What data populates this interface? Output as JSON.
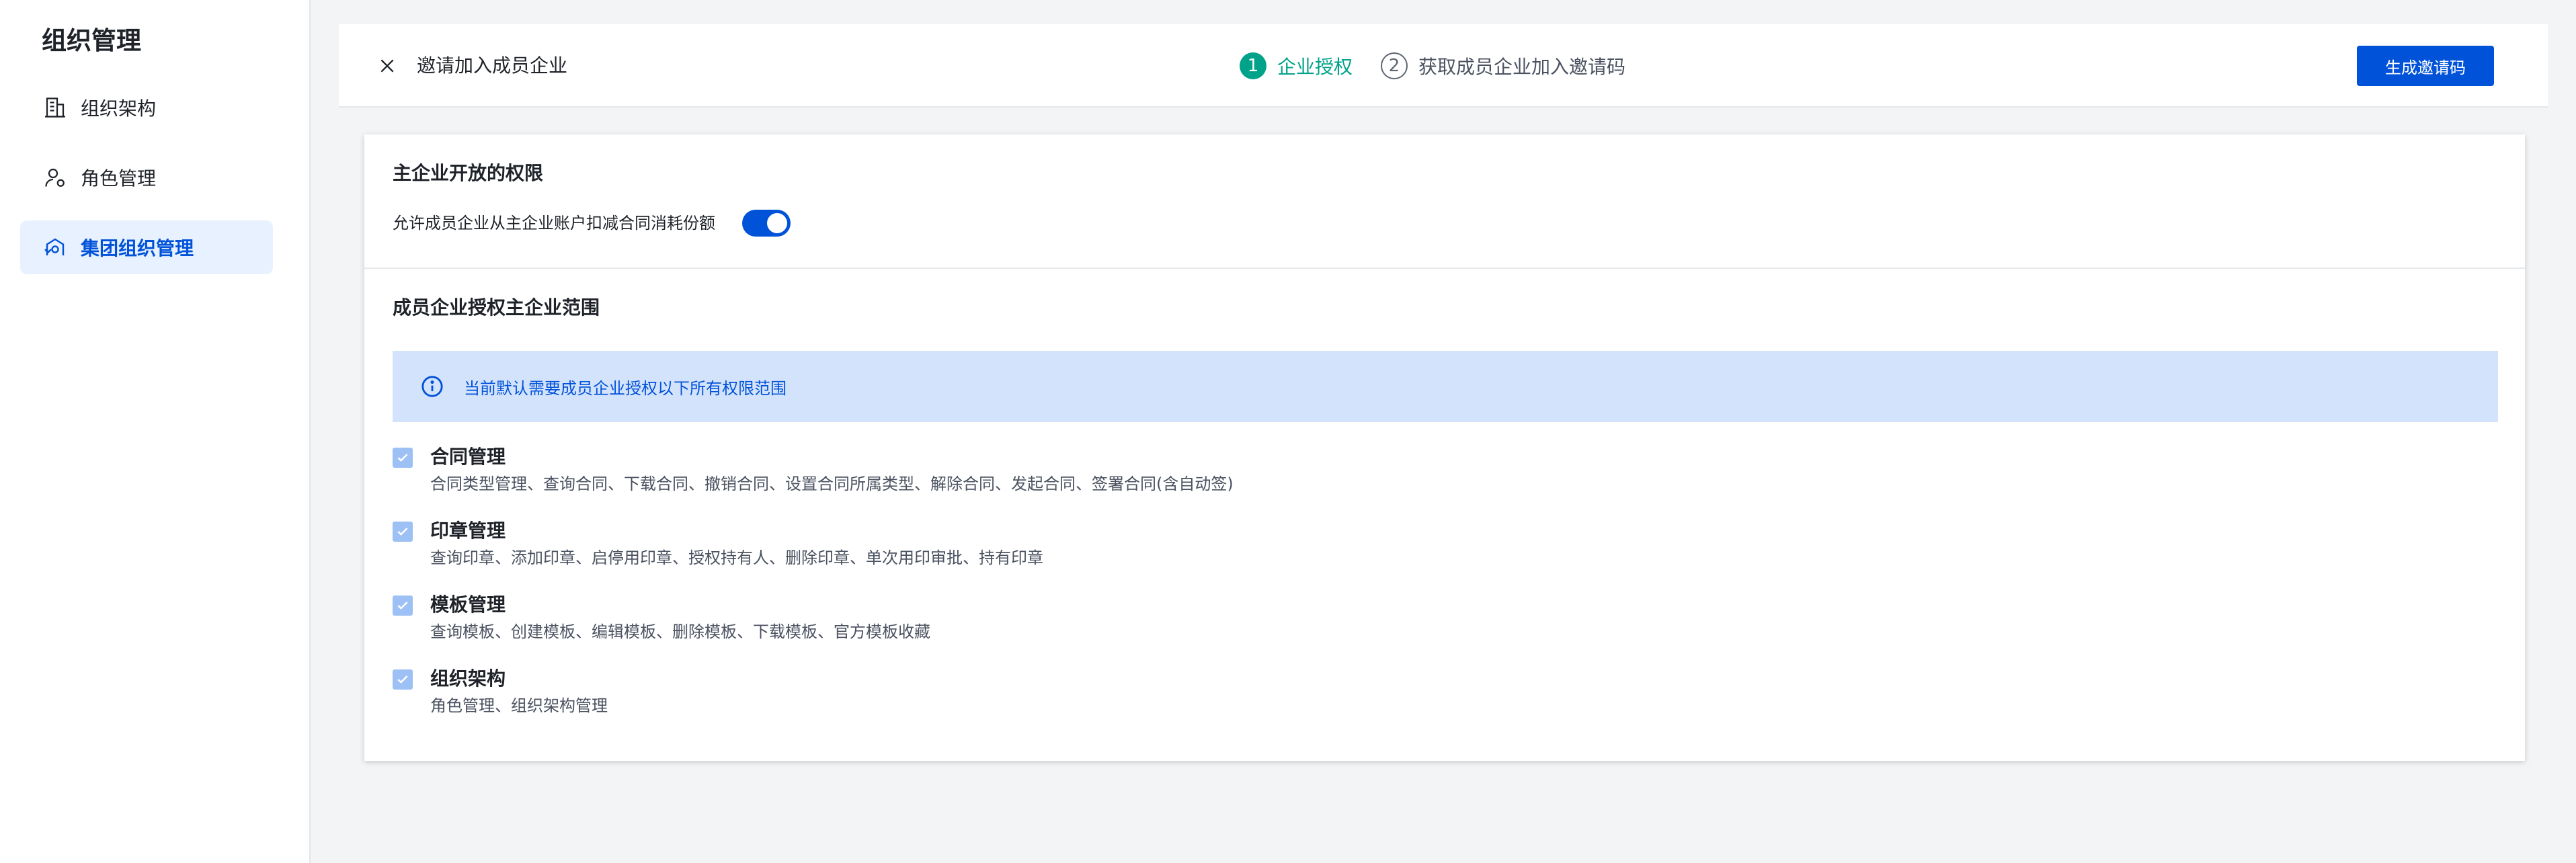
{
  "sidebar": {
    "title": "组织管理",
    "items": [
      {
        "label": "组织架构",
        "icon": "building-icon",
        "active": false
      },
      {
        "label": "角色管理",
        "icon": "user-role-icon",
        "active": false
      },
      {
        "label": "集团组织管理",
        "icon": "group-org-icon",
        "active": true
      }
    ]
  },
  "topbar": {
    "title": "邀请加入成员企业",
    "steps": [
      {
        "num": "1",
        "label": "企业授权",
        "state": "active"
      },
      {
        "num": "2",
        "label": "获取成员企业加入邀请码",
        "state": "inactive"
      }
    ],
    "action_label": "生成邀请码"
  },
  "permissions": {
    "title": "主企业开放的权限",
    "toggle_label": "允许成员企业从主企业账户扣减合同消耗份额",
    "toggle_on": true
  },
  "scope": {
    "title": "成员企业授权主企业范围",
    "notice": "当前默认需要成员企业授权以下所有权限范围",
    "items": [
      {
        "title": "合同管理",
        "desc": "合同类型管理、查询合同、下载合同、撤销合同、设置合同所属类型、解除合同、发起合同、签署合同(含自动签)",
        "checked": true
      },
      {
        "title": "印章管理",
        "desc": "查询印章、添加印章、启停用印章、授权持有人、删除印章、单次用印审批、持有印章",
        "checked": true
      },
      {
        "title": "模板管理",
        "desc": "查询模板、创建模板、编辑模板、删除模板、下载模板、官方模板收藏",
        "checked": true
      },
      {
        "title": "组织架构",
        "desc": "角色管理、组织架构管理",
        "checked": true
      }
    ]
  },
  "colors": {
    "primary": "#0052d9",
    "step_active": "#00a389",
    "notice_bg": "#d4e3fc",
    "checkbox_disabled": "#9dc0f5"
  }
}
